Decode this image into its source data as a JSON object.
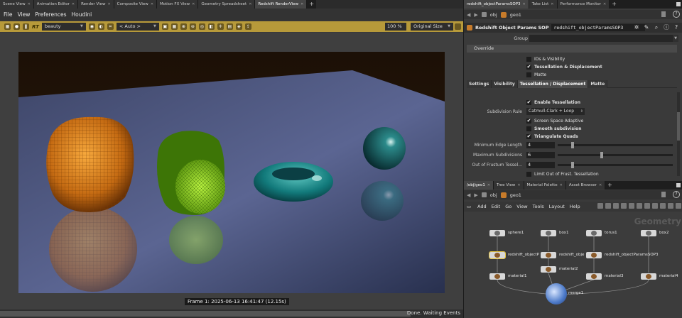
{
  "left_tabs": [
    "Scene View",
    "Animation Editor",
    "Render View",
    "Composite View",
    "Motion FX View",
    "Geometry Spreadsheet",
    "Redshift RenderView"
  ],
  "left_active_tab": 6,
  "menubar": [
    "File",
    "View",
    "Preferences",
    "Houdini"
  ],
  "render_toolbar": {
    "rt_label": "RT",
    "aov": "beauty",
    "region": "< Auto >",
    "zoom": "100 %",
    "size": "Original Size"
  },
  "frame_label": "Frame 1: 2025-06-13 16:41:47 (12.15s)",
  "status": "Done. Waiting Events",
  "right_tabs_top": [
    "redshift_objectParamsSOP3",
    "Take List",
    "Performance Monitor"
  ],
  "path_top": {
    "context": "obj",
    "node": "geo1"
  },
  "parm": {
    "node_type": "Redshift Object Params SOP",
    "node_name": "redshift_objectParamsSOP3",
    "group_label": "Group",
    "group_value": "",
    "override_label": "Override",
    "override_items": [
      {
        "label": "IDs & Visibility",
        "checked": false
      },
      {
        "label": "Tessellation & Displacement",
        "checked": true
      },
      {
        "label": "Matte",
        "checked": false
      }
    ],
    "tabs": [
      "Settings",
      "Visibility",
      "Tessellation / Displacement",
      "Matte"
    ],
    "active_tab": 2,
    "enable_tessellation": "Enable Tessellation",
    "subdivision_rule_label": "Subdivision Rule",
    "subdivision_rule_value": "Catmull-Clark + Loop",
    "screen_space": "Screen Space Adaptive",
    "smooth_subdivision": "Smooth subdivision",
    "triangulate_quads": "Triangulate Quads",
    "min_edge_label": "Minimum Edge Length",
    "min_edge_value": "4",
    "max_subdiv_label": "Maximum Subdivisions",
    "max_subdiv_value": "6",
    "out_frustum_label": "Out of Frustum Tessel...",
    "out_frustum_value": "4",
    "limit_out_frustum": "Limit Out of Frust. Tessellation",
    "slider_min_edge": 0.12,
    "slider_max_subdiv": 0.38,
    "slider_out_frustum": 0.12
  },
  "right_tabs_bottom": [
    "/obj/geo1",
    "Tree View",
    "Material Palette",
    "Asset Browser"
  ],
  "path_bottom": {
    "context": "obj",
    "node": "geo1"
  },
  "net_menu": [
    "Add",
    "Edit",
    "Go",
    "View",
    "Tools",
    "Layout",
    "Help"
  ],
  "network": {
    "watermark": "Geometry",
    "nodes": {
      "sphere1": "sphere1",
      "box1": "box1",
      "torus1": "torus1",
      "box2": "box2",
      "rs1": "redshift_objectP",
      "rs2": "redshift_obje",
      "rs3": "redshift_objectParamsSOP3",
      "material2": "material2",
      "material1": "material1",
      "material3": "material3",
      "material4": "material4",
      "merge1": "merge1"
    }
  },
  "colors": {
    "toolbar": "#b79a3a",
    "selected_node": "#e5c440",
    "accent_node": "#c77b2a"
  }
}
